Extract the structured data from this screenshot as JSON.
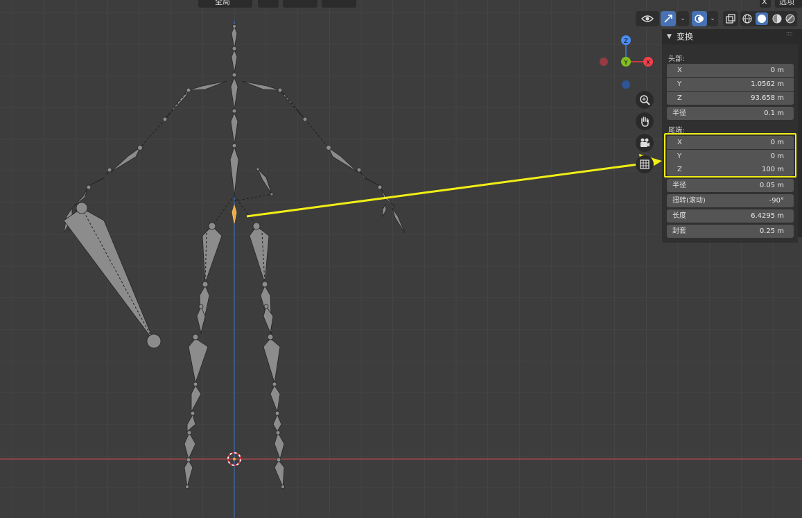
{
  "header": {
    "pivot_label": "全局",
    "right_x_label": "X",
    "options_label": "选项"
  },
  "transform_panel": {
    "title": "变换",
    "head": {
      "label": "头部:",
      "x": {
        "axis": "X",
        "value": "0 m"
      },
      "y": {
        "axis": "Y",
        "value": "1.0562 m"
      },
      "z": {
        "axis": "Z",
        "value": "93.658 m"
      },
      "radius": {
        "label": "半径",
        "value": "0.1 m"
      }
    },
    "tail": {
      "label": "尾端:",
      "x": {
        "axis": "X",
        "value": "0 m"
      },
      "y": {
        "axis": "Y",
        "value": "0 m"
      },
      "z": {
        "axis": "Z",
        "value": "100 m"
      },
      "radius": {
        "label": "半径",
        "value": "0.05 m"
      }
    },
    "roll": {
      "label": "扭转(滚动)",
      "value": "-90°"
    },
    "length": {
      "label": "长度",
      "value": "6.4295 m"
    },
    "envelope": {
      "label": "封套",
      "value": "0.25 m"
    }
  },
  "gizmo": {
    "z_label": "Z",
    "y_label": "Y",
    "x_label": "X"
  },
  "colors": {
    "background": "#3d3d3d",
    "grid": "#4a4a4a",
    "x_axis": "#b5484f",
    "z_axis": "#3d6db0",
    "highlight": "#f1ee16",
    "selected_bone": "#f3a93b",
    "bone_fill": "#8c8c8c"
  },
  "icons": [
    "eye-icon",
    "move-gizmo-icon",
    "overlay-icon",
    "xray-icon",
    "wireframe-shading-icon",
    "solid-shading-icon",
    "material-shading-icon",
    "rendered-shading-icon",
    "zoom-icon",
    "hand-pan-icon",
    "camera-icon",
    "grid-ortho-icon"
  ]
}
